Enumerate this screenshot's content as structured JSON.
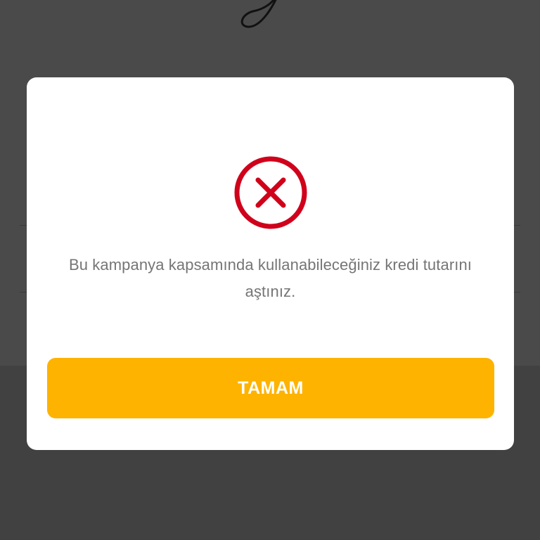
{
  "background": {
    "overlay_color": "#414141"
  },
  "dialog": {
    "icon": "error-x-circle-icon",
    "icon_color": "#d0021b",
    "message": "Bu kampanya kapsamında kullanabileceğiniz kredi tutarını aştınız.",
    "confirm_label": "TAMAM",
    "confirm_color": "#fdb300"
  }
}
